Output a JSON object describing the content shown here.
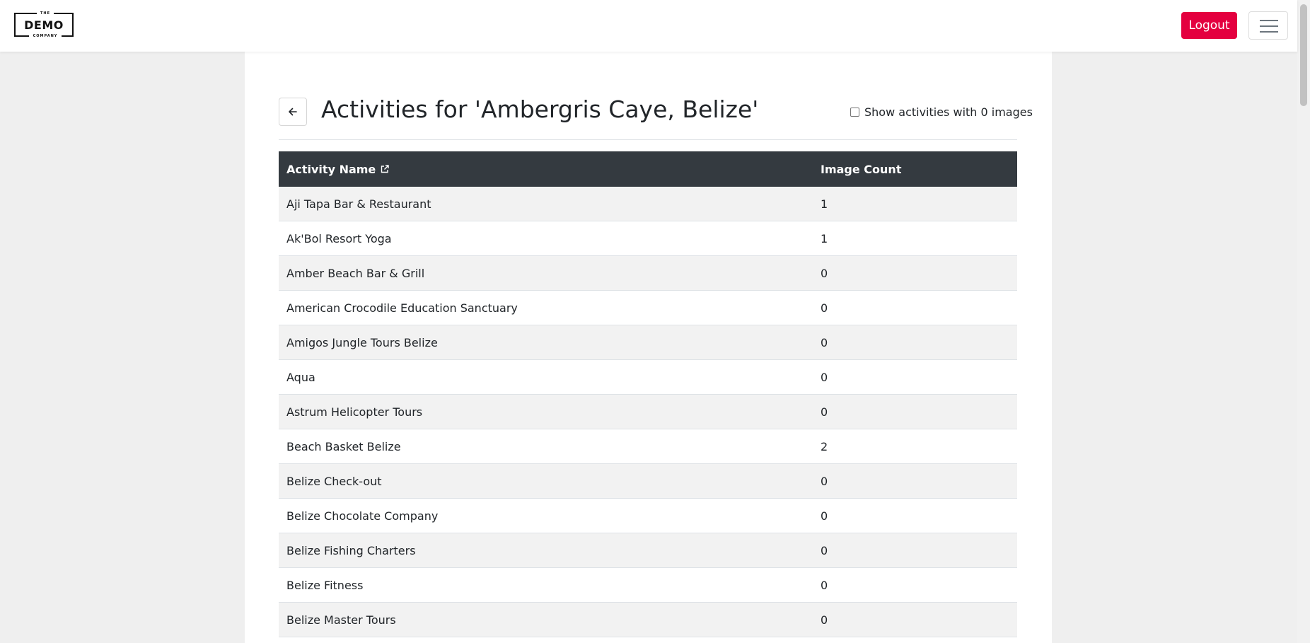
{
  "header": {
    "logo": {
      "top": "THE",
      "main": "DEMO",
      "bottom": "COMPANY"
    },
    "logout_label": "Logout",
    "menu_icon": "hamburger-icon",
    "accent_color": "#e4003f"
  },
  "page": {
    "back_icon": "arrow-left-icon",
    "title": "Activities for 'Ambergris Caye, Belize'",
    "zero_images_toggle": {
      "label": "Show activities with 0 images",
      "checked": false
    }
  },
  "table": {
    "columns": {
      "name": "Activity Name",
      "name_icon": "external-link-icon",
      "count": "Image Count"
    },
    "rows": [
      {
        "name": "Aji Tapa Bar & Restaurant",
        "count": "1"
      },
      {
        "name": "Ak'Bol Resort Yoga",
        "count": "1"
      },
      {
        "name": "Amber Beach Bar & Grill",
        "count": "0"
      },
      {
        "name": "American Crocodile Education Sanctuary",
        "count": "0"
      },
      {
        "name": "Amigos Jungle Tours Belize",
        "count": "0"
      },
      {
        "name": "Aqua",
        "count": "0"
      },
      {
        "name": "Astrum Helicopter Tours",
        "count": "0"
      },
      {
        "name": "Beach Basket Belize",
        "count": "2"
      },
      {
        "name": "Belize Check-out",
        "count": "0"
      },
      {
        "name": "Belize Chocolate Company",
        "count": "0"
      },
      {
        "name": "Belize Fishing Charters",
        "count": "0"
      },
      {
        "name": "Belize Fitness",
        "count": "0"
      },
      {
        "name": "Belize Master Tours",
        "count": "0"
      }
    ]
  }
}
